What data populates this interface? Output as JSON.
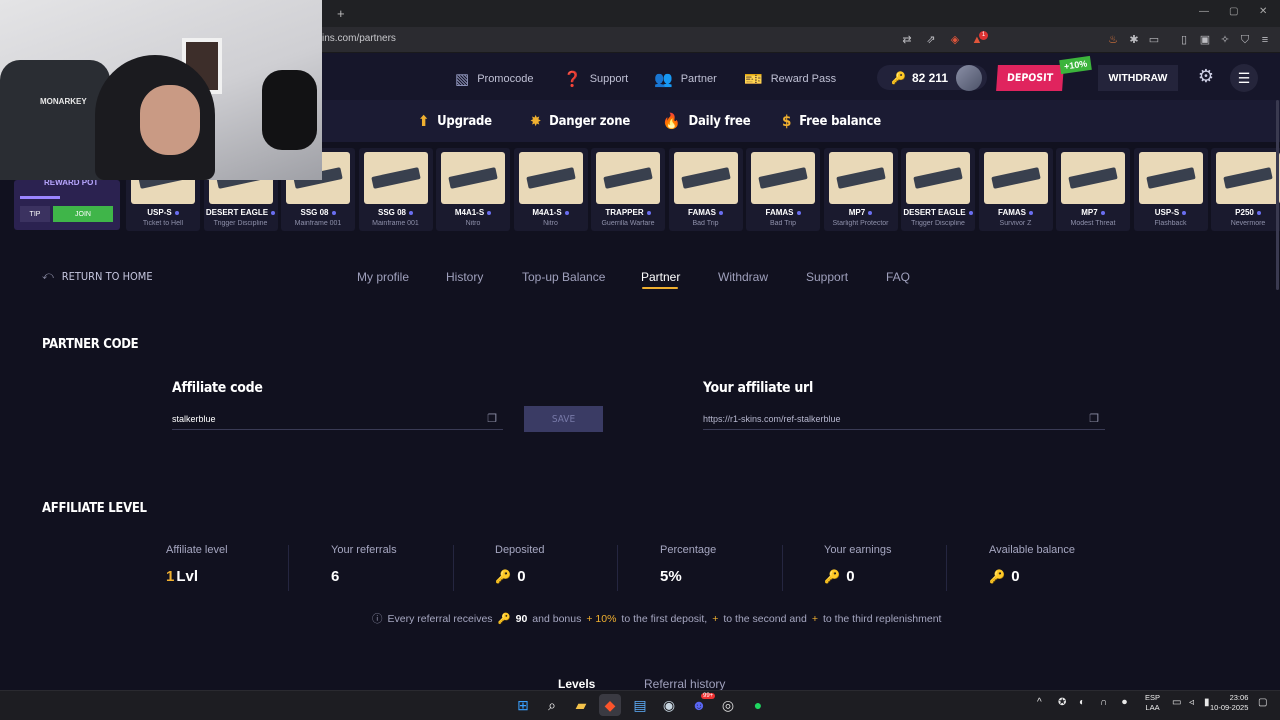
{
  "browser": {
    "url_text": "ins.com/partners",
    "new_tab_label": "+",
    "window_controls": [
      "—",
      "▢",
      "✕"
    ],
    "ext_badge": "1"
  },
  "header": {
    "nav": [
      {
        "label": "Promocode",
        "icon": "promocode-icon"
      },
      {
        "label": "Support",
        "icon": "question-icon"
      },
      {
        "label": "Partner",
        "icon": "partner-icon"
      },
      {
        "label": "Reward Pass",
        "icon": "ticket-icon"
      }
    ],
    "balance": "82 211",
    "deposit_label": "DEPOSIT",
    "deposit_bonus": "+10%",
    "withdraw_label": "WITHDRAW"
  },
  "subnav": [
    {
      "label": "Upgrade",
      "icon": "arrow-up-icon"
    },
    {
      "label": "Danger zone",
      "icon": "explosion-icon"
    },
    {
      "label": "Daily free",
      "icon": "flame-icon"
    },
    {
      "label": "Free balance",
      "icon": "dollar-icon"
    }
  ],
  "promo": {
    "title": "REWARD POT",
    "tip_label": "TIP",
    "join_label": "JOIN"
  },
  "drops": [
    {
      "name": "USP-S",
      "skin": "Ticket to Hell"
    },
    {
      "name": "DESERT EAGLE",
      "skin": "Trigger Discipline"
    },
    {
      "name": "SSG 08",
      "skin": "Mainframe 001"
    },
    {
      "name": "SSG 08",
      "skin": "Mainframe 001"
    },
    {
      "name": "M4A1-S",
      "skin": "Nitro"
    },
    {
      "name": "M4A1-S",
      "skin": "Nitro"
    },
    {
      "name": "TRAPPER",
      "skin": "Guerrilla Warfare"
    },
    {
      "name": "FAMAS",
      "skin": "Bad Trip"
    },
    {
      "name": "FAMAS",
      "skin": "Bad Trip"
    },
    {
      "name": "MP7",
      "skin": "Starlight Protector"
    },
    {
      "name": "DESERT EAGLE",
      "skin": "Trigger Discipline"
    },
    {
      "name": "FAMAS",
      "skin": "Survivor Z"
    },
    {
      "name": "MP7",
      "skin": "Modest Threat"
    },
    {
      "name": "USP-S",
      "skin": "Flashback"
    },
    {
      "name": "P250",
      "skin": "Nevermore"
    }
  ],
  "webcam": {
    "chair_brand": "MONARKEY"
  },
  "page": {
    "back_label": "RETURN TO HOME",
    "tabs": [
      "My profile",
      "History",
      "Top-up Balance",
      "Partner",
      "Withdraw",
      "Support",
      "FAQ"
    ],
    "active_tab": "Partner",
    "partner_code_title": "PARTNER CODE",
    "affiliate_code_label": "Affiliate code",
    "affiliate_code_value": "stalkerblue",
    "save_label": "SAVE",
    "affiliate_url_label": "Your affiliate url",
    "affiliate_url_value": "https://r1-skins.com/ref-stalkerblue",
    "affiliate_level_title": "AFFILIATE LEVEL",
    "stats": [
      {
        "label": "Affiliate level",
        "value": "Lvl",
        "prefix": "1"
      },
      {
        "label": "Your referrals",
        "value": "6"
      },
      {
        "label": "Deposited",
        "value": "0",
        "key": true
      },
      {
        "label": "Percentage",
        "value": "5%"
      },
      {
        "label": "Your earnings",
        "value": "0",
        "key": true
      },
      {
        "label": "Available balance",
        "value": "0",
        "key": true
      }
    ],
    "note": {
      "part1": "Every referral receives",
      "amount": "90",
      "part2": "and bonus",
      "bonus": "+ 10%",
      "part3": "to the first deposit,",
      "plus2": "+",
      "part4": "to the second and",
      "plus3": "+",
      "part5": "to the third replenishment"
    },
    "bottom_tabs": [
      "Levels",
      "Referral history"
    ]
  },
  "taskbar": {
    "lang": "ESP",
    "lang2": "LAA",
    "time": "23:06",
    "date": "10-09-2025",
    "discord_badge": "99+"
  },
  "colors": {
    "accent": "#f0b030",
    "deposit": "#e0245e",
    "join": "#3fb549",
    "bg": "#11111f"
  }
}
